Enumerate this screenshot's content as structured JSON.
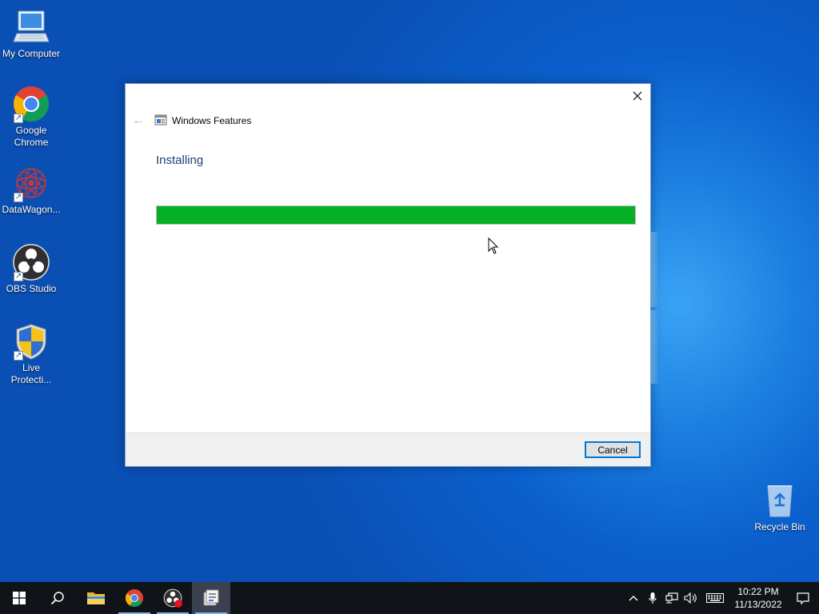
{
  "desktop": {
    "icons": [
      {
        "label": "My Computer",
        "icon": "computer-icon"
      },
      {
        "label": "Google Chrome",
        "icon": "chrome-icon"
      },
      {
        "label": "DataWagon...",
        "icon": "datawagon-icon"
      },
      {
        "label": "OBS Studio",
        "icon": "obs-icon"
      },
      {
        "label": "Live Protecti...",
        "icon": "shield-icon"
      },
      {
        "label": "Recycle Bin",
        "icon": "recycle-bin-icon"
      }
    ]
  },
  "dialog": {
    "title": "Windows Features",
    "heading": "Installing",
    "progress": 1.0,
    "cancel_label": "Cancel",
    "accent": "#0078d7",
    "progress_color": "#06b025"
  },
  "taskbar": {
    "time": "10:22 PM",
    "date": "11/13/2022"
  }
}
